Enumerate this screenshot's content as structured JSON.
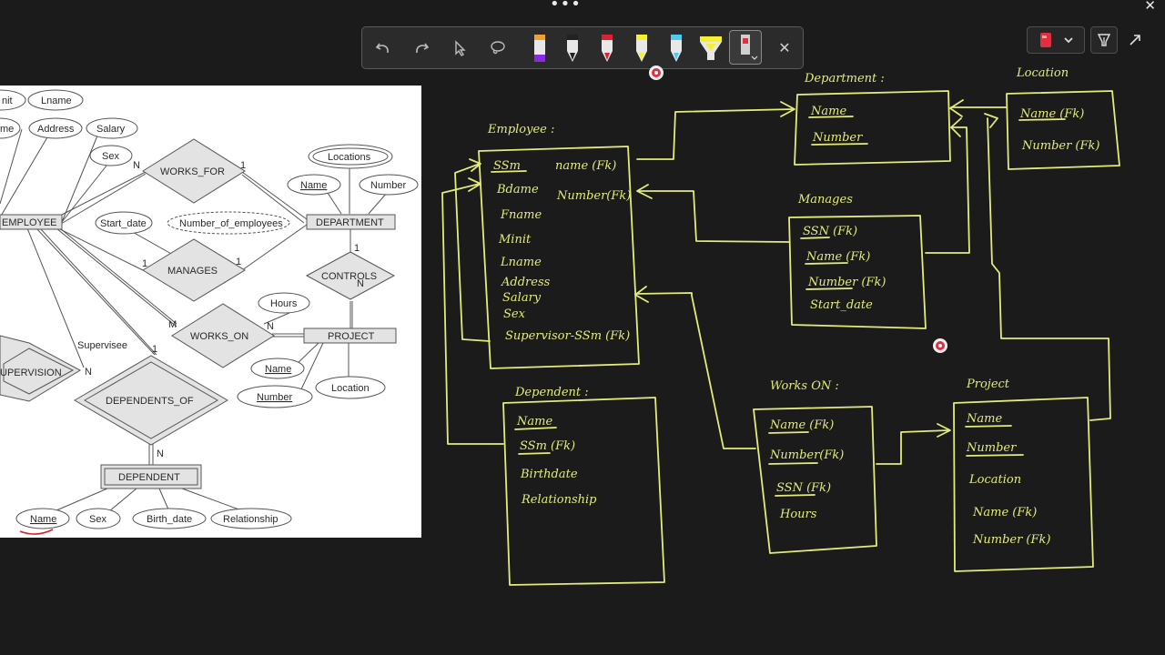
{
  "window": {
    "menu_dots": "•••",
    "close": "✕"
  },
  "toolbar": {
    "tools": [
      "undo-icon",
      "redo-icon",
      "select-pointer-icon",
      "lasso-icon",
      "pen-purple-icon",
      "pen-black-icon",
      "pen-red-icon",
      "highlighter-yellow-icon",
      "highlighter-blue-icon",
      "highlighter-large-yellow-icon",
      "eraser-icon"
    ],
    "close": "✕"
  },
  "right_controls": {
    "notebook": "notebook-icon",
    "chevron": "chevron-down-icon",
    "funnel": "filter-icon",
    "expand": "expand-icon"
  },
  "colors": {
    "ink": "#e3ec7a",
    "background": "#1b1b1b",
    "toolbar": "#2b2b2b",
    "record": "#e03040"
  },
  "er_diagram": {
    "entities": [
      "EMPLOYEE",
      "DEPARTMENT",
      "PROJECT",
      "DEPENDENT"
    ],
    "relationships": [
      "WORKS_FOR",
      "MANAGES",
      "CONTROLS",
      "WORKS_ON",
      "SUPERVISION",
      "DEPENDENTS_OF"
    ],
    "attributes": {
      "employee": [
        "Minit",
        "Lname",
        "Fname",
        "Address",
        "Salary",
        "Sex"
      ],
      "department": [
        "Locations",
        "Name",
        "Number",
        "Number_of_employees"
      ],
      "manages": [
        "Start_date"
      ],
      "works_on": [
        "Hours"
      ],
      "project": [
        "Name",
        "Number",
        "Location"
      ],
      "dependent": [
        "Name",
        "Sex",
        "Birth_date",
        "Relationship"
      ]
    },
    "cardinalities": {
      "works_for_emp": "N",
      "works_for_dept": "1",
      "manages_emp": "1",
      "manages_dept": "1",
      "controls_dept": "1",
      "controls_proj": "N",
      "works_on_emp": "M",
      "works_on_proj": "N",
      "supervisee": "Supervisee",
      "supervision_n": "N",
      "dependents_emp": "1",
      "dependents_dep": "N"
    },
    "left_cut": {
      "minit": "nit",
      "fname": "me",
      "supervision": "UPERVISION"
    }
  },
  "sketch": {
    "employee": {
      "title": "Employee :",
      "fields": [
        "SSm",
        "Bdame",
        "Fname",
        "Minit",
        "Lname",
        "Address",
        "Salary",
        "Sex",
        "Supervisor-SSm (Fk)"
      ],
      "fk1": "name (Fk)",
      "fk2": "Number(Fk)"
    },
    "department": {
      "title": "Department :",
      "fields": [
        "Name",
        "Number"
      ]
    },
    "location": {
      "title": "Location",
      "fields": [
        "Name (Fk)",
        "Number (Fk)"
      ]
    },
    "manages": {
      "title": "Manages",
      "fields": [
        "SSN (Fk)",
        "Name (Fk)",
        "Number (Fk)",
        "Start_date"
      ]
    },
    "dependent": {
      "title": "Dependent :",
      "fields": [
        "Name",
        "SSm (Fk)",
        "Birthdate",
        "Relationship"
      ]
    },
    "works_on": {
      "title": "Works ON :",
      "fields": [
        "Name (Fk)",
        "Number(Fk)",
        "SSN (Fk)",
        "Hours"
      ]
    },
    "project": {
      "title": "Project",
      "fields": [
        "Name",
        "Number",
        "Location",
        "Name (Fk)",
        "Number (Fk)"
      ]
    }
  }
}
